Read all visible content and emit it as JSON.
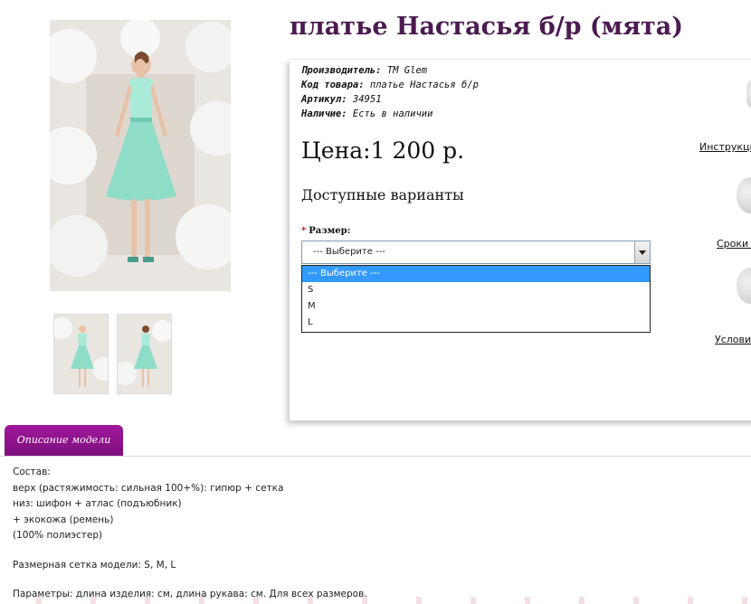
{
  "product": {
    "title": "платье Настасья б/р (мята)",
    "meta": [
      {
        "label": "Производитель:",
        "value": "ТМ Glem"
      },
      {
        "label": "Код товара:",
        "value": "платье Настасья б/р"
      },
      {
        "label": "Артикул:",
        "value": "34951"
      },
      {
        "label": "Наличие:",
        "value": "Есть в наличии"
      }
    ],
    "price": "Цена:1 200 р.",
    "variants_title": "Доступные варианты",
    "size_required_mark": "*",
    "size_label": "Размер:",
    "size_select_value": "--- Выберите ---",
    "size_options": [
      "--- Выберите ---",
      "S",
      "M",
      "L"
    ]
  },
  "side_links": [
    "Инструкци",
    "Сроки д",
    "Условия"
  ],
  "tabs": {
    "description": "Описание модели"
  },
  "description": {
    "composition_label": "Состав:",
    "composition_lines": [
      "верх (растяжимость: сильная 100+%): гипюр + сетка",
      "низ: шифон + атлас (подъюбник)",
      "+ экокожа (ремень)",
      "(100% полиэстер)"
    ],
    "size_grid_label": "Размерная сетка модели:",
    "size_grid_value": "S, M, L",
    "params_label": "Параметры:",
    "params_value": "длина изделия: см, длина рукава: см. Для всех размеров."
  },
  "colors": {
    "title": "#4c1a52",
    "tab": "#8e138b",
    "dress": "#8fdcc7",
    "selection": "#3399ff"
  }
}
